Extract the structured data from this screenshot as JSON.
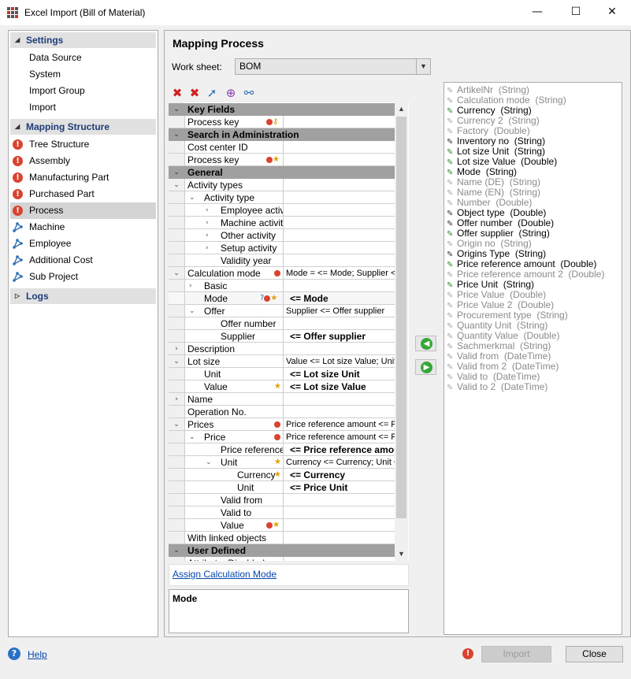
{
  "window": {
    "title": "Excel Import (Bill of Material)",
    "minimize": "—",
    "maximize": "☐",
    "close": "✕"
  },
  "sidebar": {
    "settings": {
      "label": "Settings",
      "items": [
        "Data Source",
        "System",
        "Import Group",
        "Import"
      ]
    },
    "mapping": {
      "label": "Mapping Structure",
      "items": [
        {
          "label": "Tree Structure",
          "icon": "error"
        },
        {
          "label": "Assembly",
          "icon": "error"
        },
        {
          "label": "Manufacturing Part",
          "icon": "error"
        },
        {
          "label": "Purchased Part",
          "icon": "error"
        },
        {
          "label": "Process",
          "icon": "error",
          "selected": true
        },
        {
          "label": "Machine",
          "icon": "network"
        },
        {
          "label": "Employee",
          "icon": "network"
        },
        {
          "label": "Additional Cost",
          "icon": "network"
        },
        {
          "label": "Sub Project",
          "icon": "network"
        }
      ]
    },
    "logs": {
      "label": "Logs"
    }
  },
  "main": {
    "title": "Mapping Process",
    "worksheet_label": "Work sheet:",
    "worksheet_value": "BOM",
    "link": "Assign Calculation Mode",
    "desc_title": "Mode"
  },
  "grid_rows": [
    {
      "t": "section",
      "name": "Key Fields",
      "tog": "⌄"
    },
    {
      "t": "field",
      "name": "Process key",
      "lvl": 0,
      "mk": "err,key"
    },
    {
      "t": "section",
      "name": "Search in Administration",
      "tog": "⌄"
    },
    {
      "t": "field",
      "name": "Cost center ID",
      "lvl": 0
    },
    {
      "t": "field",
      "name": "Process key",
      "lvl": 0,
      "mk": "err,star"
    },
    {
      "t": "section",
      "name": "General",
      "tog": "⌄"
    },
    {
      "t": "field",
      "name": "Activity types",
      "lvl": 0,
      "tog": "⌄"
    },
    {
      "t": "field",
      "name": "Activity type",
      "lvl": 1,
      "sub": "⌄"
    },
    {
      "t": "field",
      "name": "Employee activ",
      "lvl": 2,
      "sub": "›"
    },
    {
      "t": "field",
      "name": "Machine activity",
      "lvl": 2,
      "sub": "›"
    },
    {
      "t": "field",
      "name": "Other activity",
      "lvl": 2,
      "sub": "›"
    },
    {
      "t": "field",
      "name": "Setup activity",
      "lvl": 2,
      "sub": "›"
    },
    {
      "t": "field",
      "name": "Validity year",
      "lvl": 2
    },
    {
      "t": "field",
      "name": "Calculation mode",
      "lvl": 0,
      "tog": "⌄",
      "mk": "err",
      "val": "Mode =  <= Mode; Supplier <="
    },
    {
      "t": "field",
      "name": "Basic",
      "lvl": 1,
      "sub": "›"
    },
    {
      "t": "field",
      "name": "Mode",
      "lvl": 1,
      "mk": "q,err,star",
      "val": "<= Mode",
      "bold": true,
      "sel": true
    },
    {
      "t": "field",
      "name": "Offer",
      "lvl": 1,
      "sub": "⌄",
      "val": "Supplier <= Offer supplier"
    },
    {
      "t": "field",
      "name": "Offer number",
      "lvl": 2
    },
    {
      "t": "field",
      "name": "Supplier",
      "lvl": 2,
      "val": "<= Offer supplier",
      "bold": true
    },
    {
      "t": "field",
      "name": "Description",
      "lvl": 0,
      "tog": "›"
    },
    {
      "t": "field",
      "name": "Lot size",
      "lvl": 0,
      "tog": "⌄",
      "val": "Value <= Lot size Value; Unit"
    },
    {
      "t": "field",
      "name": "Unit",
      "lvl": 1,
      "val": "<= Lot size Unit",
      "bold": true
    },
    {
      "t": "field",
      "name": "Value",
      "lvl": 1,
      "mk": "star",
      "val": "<= Lot size Value",
      "bold": true
    },
    {
      "t": "field",
      "name": "Name",
      "lvl": 0,
      "tog": "›"
    },
    {
      "t": "field",
      "name": "Operation No.",
      "lvl": 0
    },
    {
      "t": "field",
      "name": "Prices",
      "lvl": 0,
      "tog": "⌄",
      "mk": "err",
      "val": "Price reference amount <= Pric"
    },
    {
      "t": "field",
      "name": "Price",
      "lvl": 1,
      "sub": "⌄",
      "mk": "err",
      "val": "Price reference amount <= Pri"
    },
    {
      "t": "field",
      "name": "Price reference",
      "lvl": 2,
      "val": "<= Price reference amou",
      "bold": true
    },
    {
      "t": "field",
      "name": "Unit",
      "lvl": 2,
      "sub": "⌄",
      "mk": "star",
      "val": "Currency <= Currency; Unit <="
    },
    {
      "t": "field",
      "name": "Currency",
      "lvl": 3,
      "mk": "star",
      "val": "<= Currency",
      "bold": true
    },
    {
      "t": "field",
      "name": "Unit",
      "lvl": 3,
      "val": "<= Price Unit",
      "bold": true
    },
    {
      "t": "field",
      "name": "Valid from",
      "lvl": 2
    },
    {
      "t": "field",
      "name": "Valid to",
      "lvl": 2
    },
    {
      "t": "field",
      "name": "Value",
      "lvl": 2,
      "mk": "err,star"
    },
    {
      "t": "field",
      "name": "With linked objects",
      "lvl": 0
    },
    {
      "t": "section",
      "name": "User Defined",
      "tog": "⌄"
    },
    {
      "t": "field",
      "name": "Attribute_Disabled",
      "lvl": 0
    }
  ],
  "attributes": [
    {
      "name": "ArtikelNr",
      "type": "(String)",
      "s": "d"
    },
    {
      "name": "Calculation mode",
      "type": "(String)",
      "s": "d"
    },
    {
      "name": "Currency",
      "type": "(String)",
      "s": "g"
    },
    {
      "name": "Currency 2",
      "type": "(String)",
      "s": "d"
    },
    {
      "name": "Factory",
      "type": "(Double)",
      "s": "d"
    },
    {
      "name": "Inventory no",
      "type": "(String)",
      "s": "k"
    },
    {
      "name": "Lot size Unit",
      "type": "(String)",
      "s": "g"
    },
    {
      "name": "Lot size Value",
      "type": "(Double)",
      "s": "g"
    },
    {
      "name": "Mode",
      "type": "(String)",
      "s": "g"
    },
    {
      "name": "Name (DE)",
      "type": "(String)",
      "s": "d"
    },
    {
      "name": "Name (EN)",
      "type": "(String)",
      "s": "d"
    },
    {
      "name": "Number",
      "type": "(Double)",
      "s": "d"
    },
    {
      "name": "Object type",
      "type": "(Double)",
      "s": "k"
    },
    {
      "name": "Offer number",
      "type": "(Double)",
      "s": "k"
    },
    {
      "name": "Offer supplier",
      "type": "(String)",
      "s": "g"
    },
    {
      "name": "Origin no",
      "type": "(String)",
      "s": "d"
    },
    {
      "name": "Origins Type",
      "type": "(String)",
      "s": "k"
    },
    {
      "name": "Price reference amount",
      "type": "(Double)",
      "s": "g"
    },
    {
      "name": "Price reference amount 2",
      "type": "(Double)",
      "s": "d"
    },
    {
      "name": "Price Unit",
      "type": "(String)",
      "s": "g"
    },
    {
      "name": "Price Value",
      "type": "(Double)",
      "s": "d"
    },
    {
      "name": "Price Value 2",
      "type": "(Double)",
      "s": "d"
    },
    {
      "name": "Procurement type",
      "type": "(String)",
      "s": "d"
    },
    {
      "name": "Quantity Unit",
      "type": "(String)",
      "s": "d"
    },
    {
      "name": "Quantity Value",
      "type": "(Double)",
      "s": "d"
    },
    {
      "name": "Sachmerkmal",
      "type": "(String)",
      "s": "d"
    },
    {
      "name": "Valid from",
      "type": "(DateTime)",
      "s": "d"
    },
    {
      "name": "Valid from 2",
      "type": "(DateTime)",
      "s": "d"
    },
    {
      "name": "Valid to",
      "type": "(DateTime)",
      "s": "d"
    },
    {
      "name": "Valid to 2",
      "type": "(DateTime)",
      "s": "d"
    }
  ],
  "footer": {
    "help": "Help",
    "import": "Import",
    "close": "Close"
  }
}
